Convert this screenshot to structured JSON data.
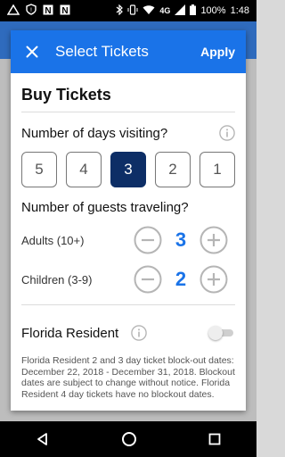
{
  "status_bar": {
    "left_icons": [
      "fandango-icon",
      "shield-icon",
      "n-app-icon",
      "n-app-icon"
    ],
    "right_icons": [
      "bluetooth-icon",
      "vibrate-icon",
      "wifi-icon",
      "lte-icon",
      "signal-icon",
      "battery-icon"
    ],
    "network": "4G",
    "battery": "100%",
    "time": "1:48"
  },
  "dialog": {
    "title": "Select Tickets",
    "apply_label": "Apply",
    "buy_title": "Buy Tickets",
    "days_question": "Number of days visiting?",
    "days_options": [
      "5",
      "4",
      "3",
      "2",
      "1"
    ],
    "selected_day": "3",
    "guests_question": "Number of guests traveling?",
    "adults_label": "Adults (10+)",
    "adults_count": "3",
    "children_label": "Children (3-9)",
    "children_count": "2",
    "resident_label": "Florida Resident",
    "resident_enabled": false,
    "note": "Florida Resident 2 and 3 day ticket block-out dates: December 22, 2018 - December 31, 2018. Blockout dates are subject to change without notice. Florida Resident 4 day tickets have no blockout dates."
  },
  "colors": {
    "accent": "#1a73e8",
    "selected_day": "#0d2e66"
  }
}
